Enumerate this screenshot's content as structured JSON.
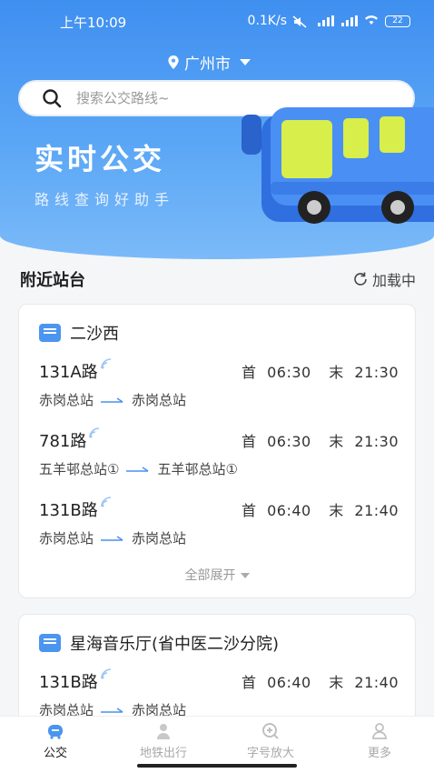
{
  "status_bar": {
    "time": "上午10:09",
    "network_speed": "0.1K/s",
    "battery": "22"
  },
  "header": {
    "city": "广州市",
    "search_placeholder": "搜索公交路线~"
  },
  "hero": {
    "title": "实时公交",
    "subtitle": "路线查询好助手"
  },
  "nearby": {
    "title": "附近站台",
    "reload_label": "加载中"
  },
  "stations": [
    {
      "name": "二沙西",
      "routes": [
        {
          "name": "131A路",
          "first_label": "首",
          "first": "06:30",
          "last_label": "末",
          "last": "21:30",
          "from": "赤岗总站",
          "to": "赤岗总站"
        },
        {
          "name": "781路",
          "first_label": "首",
          "first": "06:30",
          "last_label": "末",
          "last": "21:30",
          "from": "五羊邨总站①",
          "to": "五羊邨总站①"
        },
        {
          "name": "131B路",
          "first_label": "首",
          "first": "06:40",
          "last_label": "末",
          "last": "21:40",
          "from": "赤岗总站",
          "to": "赤岗总站"
        }
      ],
      "expand_label": "全部展开"
    },
    {
      "name": "星海音乐厅(省中医二沙分院)",
      "routes": [
        {
          "name": "131B路",
          "first_label": "首",
          "first": "06:40",
          "last_label": "末",
          "last": "21:40",
          "from": "赤岗总站",
          "to": "赤岗总站"
        }
      ]
    }
  ],
  "tabbar": {
    "items": [
      {
        "label": "公交",
        "icon": "bus-icon",
        "active": true
      },
      {
        "label": "地铁出行",
        "icon": "person-icon",
        "active": false
      },
      {
        "label": "字号放大",
        "icon": "zoom-text-icon",
        "active": false
      },
      {
        "label": "更多",
        "icon": "more-user-icon",
        "active": false
      }
    ]
  },
  "colors": {
    "accent": "#3f8ff0",
    "background": "#f5f6f8",
    "card": "#ffffff"
  }
}
